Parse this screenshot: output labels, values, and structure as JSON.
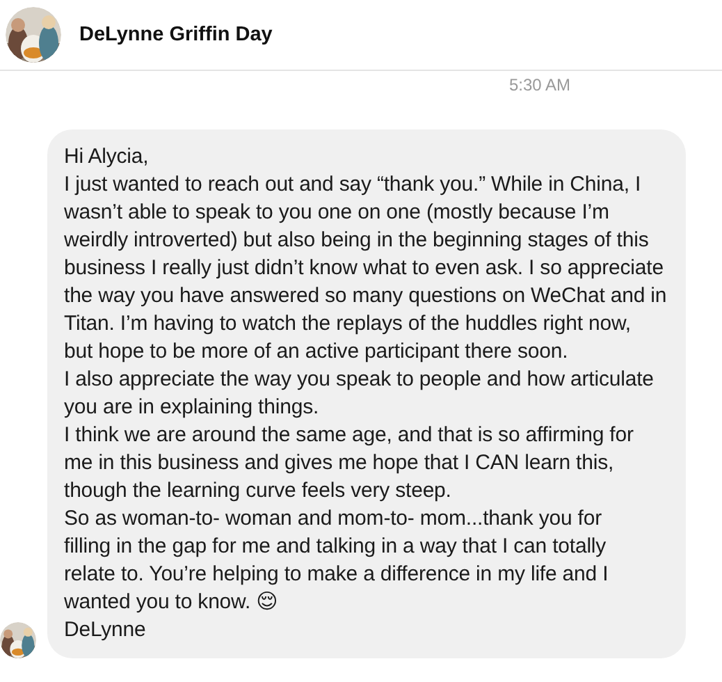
{
  "header": {
    "contact_name": "DeLynne Griffin Day"
  },
  "timestamp": "5:30 AM",
  "message": {
    "paragraphs": [
      {
        "lines": [
          "Hi Alycia,"
        ]
      },
      {
        "lines": [
          "I just wanted to reach out and say “thank you.” While in China, I",
          "wasn’t able to speak to you one on one (mostly because I’m",
          "weirdly introverted) but also being in the beginning stages of this",
          "business I really just didn’t know what to even ask. I so appreciate",
          "the way you have answered so many questions on WeChat and in",
          "Titan. I’m having to watch the replays of the huddles right now,",
          "but hope to be more of an active participant there soon."
        ]
      },
      {
        "lines": [
          "I also appreciate the way you speak to people and how articulate",
          "you are in explaining things."
        ]
      },
      {
        "lines": [
          "I think we are around the same age, and that is so affirming for",
          "me in this business and gives me hope that I CAN learn this,",
          "though the learning curve feels very steep."
        ]
      },
      {
        "lines": [
          "So as woman-to- woman and mom-to- mom...thank you for",
          "filling in the gap for me and talking in a way that I can totally",
          "relate to. You’re helping to make a difference in my life and I",
          "wanted you to know. 😌"
        ]
      },
      {
        "lines": [
          "DeLynne"
        ]
      }
    ]
  }
}
